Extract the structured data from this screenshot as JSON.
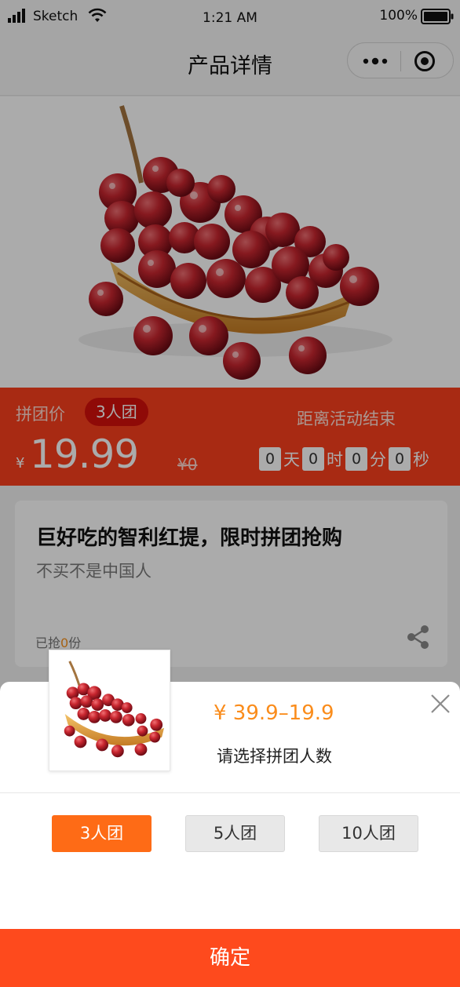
{
  "status_bar": {
    "carrier": "Sketch",
    "time": "1:21   AM",
    "battery": "100%"
  },
  "nav": {
    "title": "产品详情"
  },
  "hero": {
    "image": "red-grapes-in-basket"
  },
  "price_band": {
    "group_price_label": "拼团价",
    "group_size_badge": "3人团",
    "countdown_label": "距离活动结束",
    "currency": "¥",
    "price_current": "19.99",
    "price_original": "¥0",
    "countdown": {
      "days": "0",
      "days_unit": "天",
      "hours": "0",
      "hours_unit": "时",
      "minutes": "0",
      "minutes_unit": "分",
      "seconds": "0",
      "seconds_unit": "秒"
    }
  },
  "product": {
    "title": "巨好吃的智利红提，限时拼团抢购",
    "subtitle": "不买不是中国人",
    "sold_prefix": "已抢",
    "sold_count": "0",
    "sold_suffix": "份"
  },
  "sheet": {
    "price_range": "¥ 39.9–19.9",
    "hint": "请选择拼团人数",
    "options": [
      {
        "label": "3人团",
        "selected": true
      },
      {
        "label": "5人团",
        "selected": false
      },
      {
        "label": "10人团",
        "selected": false
      }
    ],
    "confirm_label": "确定"
  },
  "colors": {
    "price_band": "#fb3f1d",
    "badge": "#d50f0b",
    "accent_orange": "#fa8c1b",
    "selected_option": "#fe6b16",
    "confirm": "#fe4a1d"
  },
  "icons": {
    "signal": "cellular-signal-icon",
    "wifi": "wifi-icon",
    "battery": "battery-icon",
    "more": "more-dots-icon",
    "close_miniprogram": "target-circle-icon",
    "share": "share-icon",
    "close_sheet": "close-icon"
  }
}
